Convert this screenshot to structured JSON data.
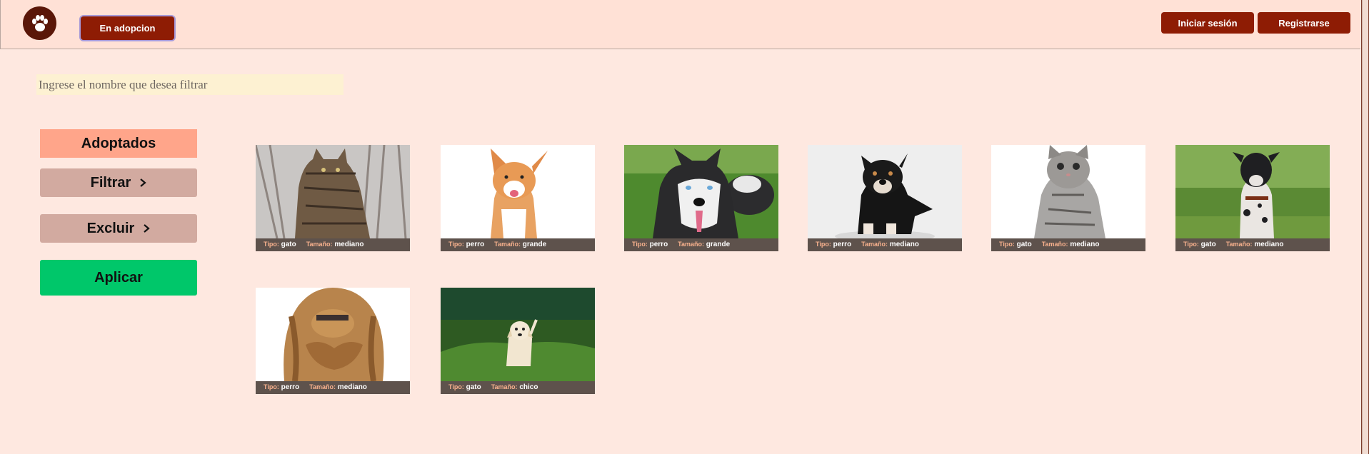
{
  "header": {
    "logo_icon": "paw-icon",
    "adopcion_label": "En adopcion",
    "login_label": "Iniciar sesión",
    "register_label": "Registrarse"
  },
  "search": {
    "placeholder": "Ingrese el nombre que desea filtrar",
    "value": ""
  },
  "sidebar": {
    "adoptados_label": "Adoptados",
    "filtrar_label": "Filtrar",
    "excluir_label": "Excluir",
    "aplicar_label": "Aplicar"
  },
  "labels": {
    "tipo": "Tipo:",
    "tamano": "Tamaño:"
  },
  "pets": [
    {
      "tipo": "gato",
      "tamano": "mediano",
      "image": "tabby-cat-photo"
    },
    {
      "tipo": "perro",
      "tamano": "grande",
      "image": "corgi-photo"
    },
    {
      "tipo": "perro",
      "tamano": "grande",
      "image": "husky-photo"
    },
    {
      "tipo": "perro",
      "tamano": "mediano",
      "image": "black-puppy-photo"
    },
    {
      "tipo": "gato",
      "tamano": "mediano",
      "image": "grey-kitten-photo"
    },
    {
      "tipo": "gato",
      "tamano": "mediano",
      "image": "great-dane-photo"
    },
    {
      "tipo": "perro",
      "tamano": "mediano",
      "image": "cocker-spaniel-photo"
    },
    {
      "tipo": "gato",
      "tamano": "chico",
      "image": "labrador-puppy-photo"
    }
  ],
  "colors": {
    "page_bg": "#fee8e0",
    "header_bg": "#ffe1d6",
    "primary": "#8e1c04",
    "adoptados_bg": "#ffa58a",
    "side_btn_bg": "#d2aaa0",
    "aplicar_bg": "#00c76a",
    "search_bg": "#fdf1d2",
    "card_info_bg": "#5e524c"
  }
}
